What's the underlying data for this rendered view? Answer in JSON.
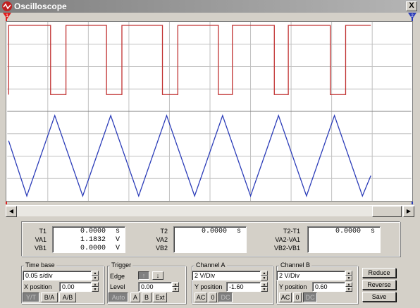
{
  "window": {
    "title": "Oscilloscope",
    "close_label": "X"
  },
  "colors": {
    "channel_a": "#c03030",
    "channel_b": "#2a3bb8",
    "cursor_1": "#e02020",
    "cursor_2": "#2a3bb8"
  },
  "markers": {
    "t1": "1",
    "t2": "2"
  },
  "scrollbar": {
    "left_arrow": "◀",
    "right_arrow": "▶"
  },
  "readout": {
    "t1_label": "T1",
    "va1_label": "VA1",
    "vb1_label": "VB1",
    "t1_value": "0.0000",
    "va1_value": "1.1832",
    "vb1_value": "0.0000",
    "t1_unit": "s",
    "va1_unit": "V",
    "vb1_unit": "V",
    "t2_label": "T2",
    "va2_label": "VA2",
    "vb2_label": "VB2",
    "t2_value": "0.0000",
    "t2_unit": "s",
    "dt_label": "T2-T1",
    "dva_label": "VA2-VA1",
    "dvb_label": "VB2-VB1",
    "dt_value": "0.0000",
    "dt_unit": "s"
  },
  "timebase": {
    "title": "Time base",
    "value": "0.05 s/div",
    "xpos_label": "X position",
    "xpos_value": "0.00",
    "modes": [
      "Y/T",
      "B/A",
      "A/B"
    ]
  },
  "trigger": {
    "title": "Trigger",
    "edge_label": "Edge",
    "level_label": "Level",
    "level_value": "0.00",
    "edge_rising": "↑",
    "edge_falling": "↓",
    "buttons": [
      "Auto",
      "A",
      "B",
      "Ext"
    ]
  },
  "channel_a": {
    "title": "Channel A",
    "value": "2 V/Div",
    "ypos_label": "Y position",
    "ypos_value": "-1.60",
    "coupling": [
      "AC",
      "0",
      "DC"
    ]
  },
  "channel_b": {
    "title": "Channel B",
    "value": "2 V/Div",
    "ypos_label": "Y position",
    "ypos_value": "0.60",
    "coupling": [
      "AC",
      "0",
      "DC"
    ]
  },
  "actions": {
    "reduce": "Reduce",
    "reverse": "Reverse",
    "save": "Save"
  }
}
